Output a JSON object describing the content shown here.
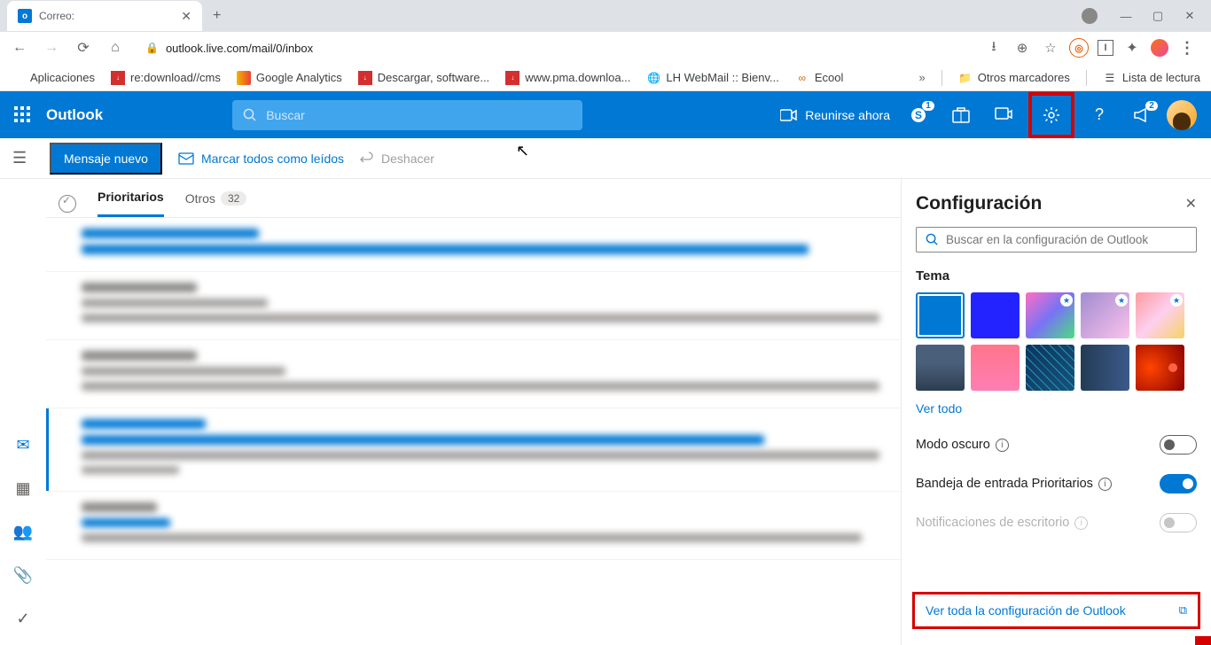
{
  "browser": {
    "tab_title": "Correo:",
    "url": "outlook.live.com/mail/0/inbox"
  },
  "bookmarks": {
    "apps": "Aplicaciones",
    "redownload": "re:download//cms",
    "ga": "Google Analytics",
    "descargar": "Descargar, software...",
    "pma": "www.pma.downloa...",
    "lh": "LH WebMail :: Bienv...",
    "ecool": "Ecool",
    "more": "Otros marcadores",
    "reading": "Lista de lectura"
  },
  "header": {
    "logo": "Outlook",
    "search_placeholder": "Buscar",
    "meet": "Reunirse ahora",
    "skype_badge": "1",
    "mega_badge": "2"
  },
  "toolbar": {
    "new_msg": "Mensaje nuevo",
    "mark_read": "Marcar todos como leídos",
    "undo": "Deshacer"
  },
  "tabs": {
    "focused": "Prioritarios",
    "other": "Otros",
    "other_count": "32"
  },
  "settings": {
    "title": "Configuración",
    "search_placeholder": "Buscar en la configuración de Outlook",
    "theme": "Tema",
    "view_all": "Ver todo",
    "dark_mode": "Modo oscuro",
    "focused_inbox": "Bandeja de entrada Prioritarios",
    "desktop_notif": "Notificaciones de escritorio",
    "view_all_settings": "Ver toda la configuración de Outlook"
  }
}
